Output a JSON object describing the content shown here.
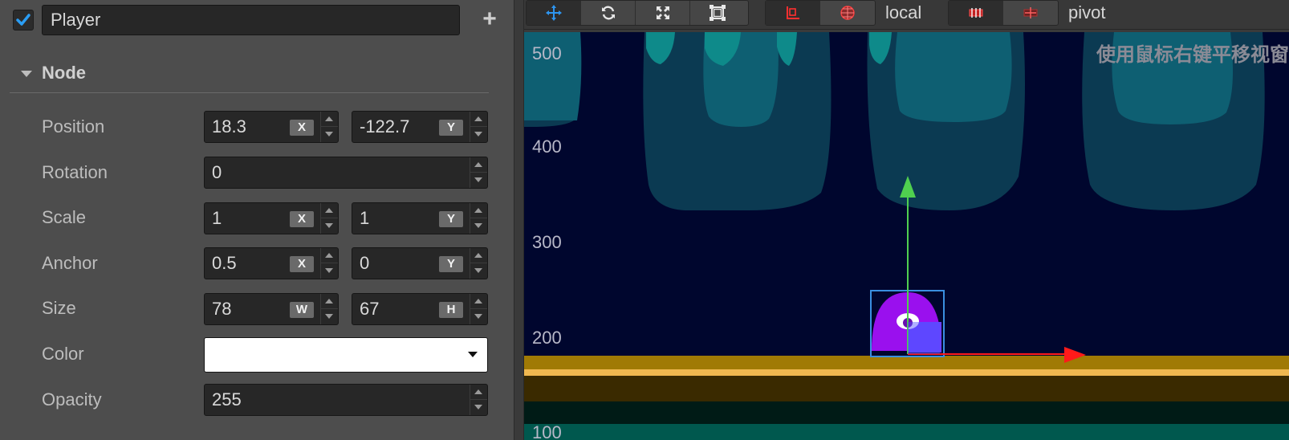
{
  "inspector": {
    "node_enabled": true,
    "node_name": "Player",
    "add_label": "+",
    "section_title": "Node",
    "properties": {
      "position": {
        "label": "Position",
        "x": "18.3",
        "y": "-122.7",
        "x_axis": "X",
        "y_axis": "Y"
      },
      "rotation": {
        "label": "Rotation",
        "value": "0"
      },
      "scale": {
        "label": "Scale",
        "x": "1",
        "y": "1",
        "x_axis": "X",
        "y_axis": "Y"
      },
      "anchor": {
        "label": "Anchor",
        "x": "0.5",
        "y": "0",
        "x_axis": "X",
        "y_axis": "Y"
      },
      "size": {
        "label": "Size",
        "w": "78",
        "h": "67",
        "w_axis": "W",
        "h_axis": "H"
      },
      "color": {
        "label": "Color",
        "value": "#ffffff"
      },
      "opacity": {
        "label": "Opacity",
        "value": "255"
      }
    }
  },
  "toolbar": {
    "transform_tools": [
      "move-tool",
      "rotate-tool",
      "scale-tool",
      "rect-tool"
    ],
    "active_tool": "move-tool",
    "coordinate_mode_label": "local",
    "pivot_mode_label": "pivot"
  },
  "scene": {
    "ruler_labels": [
      "500",
      "400",
      "300",
      "200",
      "100"
    ],
    "hint_text": "使用鼠标右键平移视窗",
    "colors": {
      "background": "#00062e",
      "platform_gold": "#a07a05",
      "platform_highlight": "#f0b850",
      "gizmo_x": "#ff1a1a",
      "gizmo_y": "#4fcf4f",
      "selection": "#3a8fe0",
      "player": "#9a10ee"
    }
  }
}
